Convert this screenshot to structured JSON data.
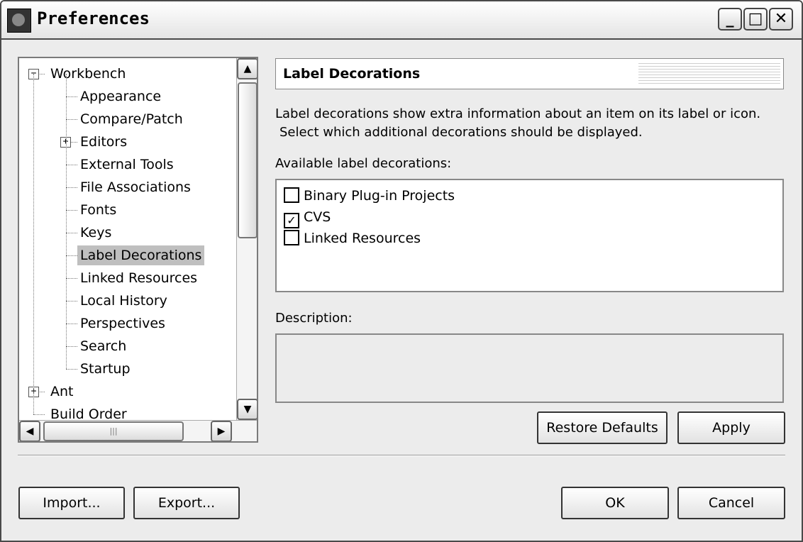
{
  "window": {
    "title": "Preferences"
  },
  "tree": {
    "items": [
      {
        "label": "Workbench",
        "level": 0,
        "expander": "minus"
      },
      {
        "label": "Appearance",
        "level": 1
      },
      {
        "label": "Compare/Patch",
        "level": 1
      },
      {
        "label": "Editors",
        "level": 1,
        "expander": "plus"
      },
      {
        "label": "External Tools",
        "level": 1
      },
      {
        "label": "File Associations",
        "level": 1
      },
      {
        "label": "Fonts",
        "level": 1
      },
      {
        "label": "Keys",
        "level": 1
      },
      {
        "label": "Label Decorations",
        "level": 1,
        "selected": true
      },
      {
        "label": "Linked Resources",
        "level": 1
      },
      {
        "label": "Local History",
        "level": 1
      },
      {
        "label": "Perspectives",
        "level": 1
      },
      {
        "label": "Search",
        "level": 1
      },
      {
        "label": "Startup",
        "level": 1
      },
      {
        "label": "Ant",
        "level": 0,
        "expander": "plus"
      },
      {
        "label": "Build Order",
        "level": 0
      }
    ]
  },
  "page": {
    "title": "Label Decorations",
    "description_line1": "Label decorations show extra information about an item on its label or icon.",
    "description_line2": "Select which additional decorations should be displayed.",
    "available_label": "Available label decorations:",
    "decorations": [
      {
        "label": "Binary Plug-in Projects",
        "checked": false
      },
      {
        "label": "CVS",
        "checked": true
      },
      {
        "label": "Linked Resources",
        "checked": false
      }
    ],
    "description_label": "Description:",
    "restore_defaults": "Restore Defaults",
    "apply": "Apply"
  },
  "footer": {
    "import": "Import...",
    "export": "Export...",
    "ok": "OK",
    "cancel": "Cancel"
  }
}
